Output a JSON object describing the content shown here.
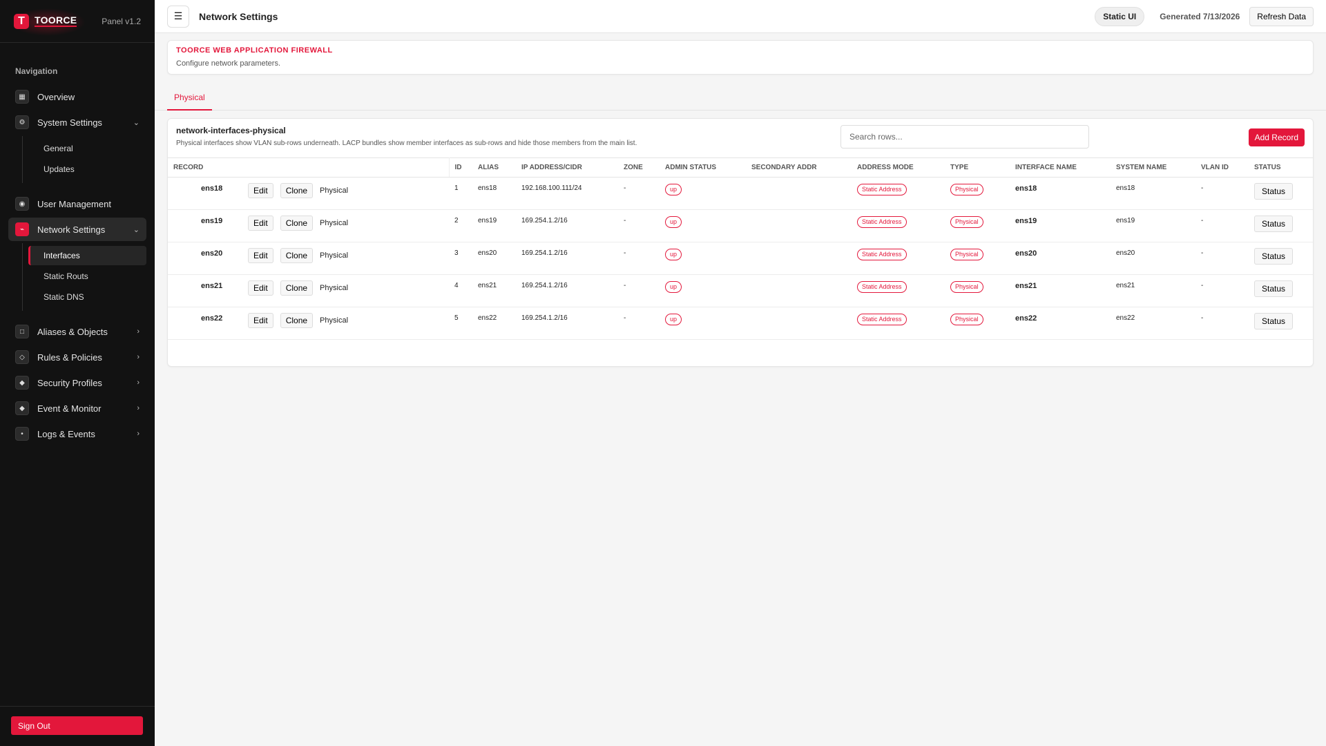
{
  "brand": {
    "logo_letter": "T",
    "name": "TOORCE",
    "panel_version": "Panel v1.2"
  },
  "nav": {
    "heading": "Navigation",
    "items": [
      {
        "label": "Overview",
        "icon": "grid-icon"
      },
      {
        "label": "System Settings",
        "icon": "gear-icon"
      },
      {
        "label": "User Management",
        "icon": "user-icon"
      },
      {
        "label": "Network Settings",
        "icon": "network-icon"
      },
      {
        "label": "Aliases & Objects",
        "icon": "square-icon"
      },
      {
        "label": "Rules & Policies",
        "icon": "diamond-icon"
      },
      {
        "label": "Security Profiles",
        "icon": "shield-icon"
      },
      {
        "label": "Event & Monitor",
        "icon": "monitor-icon"
      },
      {
        "label": "Logs & Events",
        "icon": "log-icon"
      }
    ],
    "system_sub": [
      "General",
      "Updates"
    ],
    "network_sub": [
      "Interfaces",
      "Static Routs",
      "Static DNS"
    ],
    "sign_out": "Sign Out"
  },
  "topbar": {
    "title": "Network Settings",
    "static_pill": "Static UI",
    "generated": "Generated 7/13/2026",
    "refresh": "Refresh Data"
  },
  "banner": {
    "title": "TOORCE WEB APPLICATION FIREWALL",
    "subtitle": "Configure network parameters."
  },
  "tabs": [
    "Physical"
  ],
  "card": {
    "title": "network-interfaces-physical",
    "description": "Physical interfaces show VLAN sub-rows underneath. LACP bundles show member interfaces as sub-rows and hide those members from the main list.",
    "search_placeholder": "Search rows...",
    "add_button": "Add Record"
  },
  "table": {
    "columns": [
      "RECORD",
      "ID",
      "ALIAS",
      "IP ADDRESS/CIDR",
      "ZONE",
      "ADMIN STATUS",
      "SECONDARY ADDR",
      "ADDRESS MODE",
      "TYPE",
      "INTERFACE NAME",
      "SYSTEM NAME",
      "VLAN ID",
      "STATUS"
    ],
    "edit_label": "Edit",
    "clone_label": "Clone",
    "status_label": "Status",
    "rows": [
      {
        "name": "ens18",
        "type_label": "Physical",
        "id": "1",
        "alias": "ens18",
        "ip": "192.168.100.111/24",
        "zone": "-",
        "admin": "up",
        "secondary": "",
        "mode": "Static Address",
        "type": "Physical",
        "iface": "ens18",
        "sysname": "ens18",
        "vlan": "-"
      },
      {
        "name": "ens19",
        "type_label": "Physical",
        "id": "2",
        "alias": "ens19",
        "ip": "169.254.1.2/16",
        "zone": "-",
        "admin": "up",
        "secondary": "",
        "mode": "Static Address",
        "type": "Physical",
        "iface": "ens19",
        "sysname": "ens19",
        "vlan": "-"
      },
      {
        "name": "ens20",
        "type_label": "Physical",
        "id": "3",
        "alias": "ens20",
        "ip": "169.254.1.2/16",
        "zone": "-",
        "admin": "up",
        "secondary": "",
        "mode": "Static Address",
        "type": "Physical",
        "iface": "ens20",
        "sysname": "ens20",
        "vlan": "-"
      },
      {
        "name": "ens21",
        "type_label": "Physical",
        "id": "4",
        "alias": "ens21",
        "ip": "169.254.1.2/16",
        "zone": "-",
        "admin": "up",
        "secondary": "",
        "mode": "Static Address",
        "type": "Physical",
        "iface": "ens21",
        "sysname": "ens21",
        "vlan": "-"
      },
      {
        "name": "ens22",
        "type_label": "Physical",
        "id": "5",
        "alias": "ens22",
        "ip": "169.254.1.2/16",
        "zone": "-",
        "admin": "up",
        "secondary": "",
        "mode": "Static Address",
        "type": "Physical",
        "iface": "ens22",
        "sysname": "ens22",
        "vlan": "-"
      }
    ]
  },
  "colors": {
    "accent": "#e3173b",
    "sidebar_bg": "#121212"
  }
}
